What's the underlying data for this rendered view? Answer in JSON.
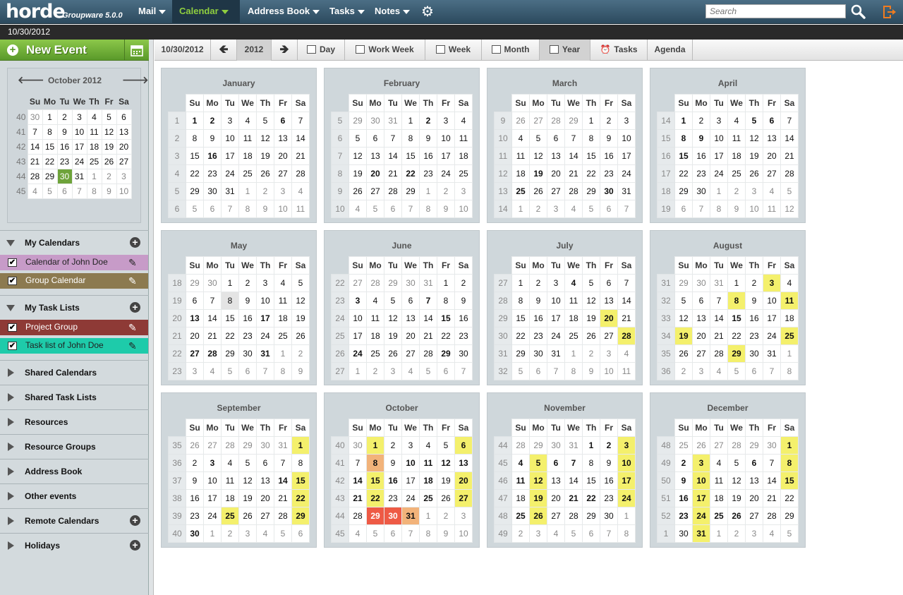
{
  "app": {
    "logo": "horde",
    "logo_sub": "Groupware 5.0.0"
  },
  "menu": [
    {
      "id": "mail",
      "label": "Mail"
    },
    {
      "id": "calendar",
      "label": "Calendar"
    },
    {
      "id": "addressbook",
      "label": "Address Book"
    },
    {
      "id": "tasks",
      "label": "Tasks"
    },
    {
      "id": "notes",
      "label": "Notes"
    }
  ],
  "search": {
    "placeholder": "Search"
  },
  "current_date": "10/30/2012",
  "sidebar": {
    "new_event": "New Event",
    "minical": {
      "title": "October 2012",
      "days": [
        "Su",
        "Mo",
        "Tu",
        "We",
        "Th",
        "Fr",
        "Sa"
      ],
      "weeks": [
        {
          "wk": "40",
          "d": [
            "30",
            "1",
            "2",
            "3",
            "4",
            "5",
            "6"
          ],
          "om": [
            0
          ]
        },
        {
          "wk": "41",
          "d": [
            "7",
            "8",
            "9",
            "10",
            "11",
            "12",
            "13"
          ],
          "om": []
        },
        {
          "wk": "42",
          "d": [
            "14",
            "15",
            "16",
            "17",
            "18",
            "19",
            "20"
          ],
          "om": []
        },
        {
          "wk": "43",
          "d": [
            "21",
            "22",
            "23",
            "24",
            "25",
            "26",
            "27"
          ],
          "om": []
        },
        {
          "wk": "44",
          "d": [
            "28",
            "29",
            "30",
            "31",
            "1",
            "2",
            "3"
          ],
          "om": [
            4,
            5,
            6
          ],
          "today": 2
        },
        {
          "wk": "45",
          "d": [
            "4",
            "5",
            "6",
            "7",
            "8",
            "9",
            "10"
          ],
          "om": [
            0,
            1,
            2,
            3,
            4,
            5,
            6
          ]
        }
      ]
    },
    "my_calendars": "My Calendars",
    "calendars": [
      {
        "name": "Calendar of John Doe",
        "color": "#c79bc8",
        "text": "#222"
      },
      {
        "name": "Group Calendar",
        "color": "#8c7a50",
        "text": "#fff"
      }
    ],
    "my_task_lists": "My Task Lists",
    "task_lists": [
      {
        "name": "Project Group",
        "color": "#8e3a36",
        "text": "#fff"
      },
      {
        "name": "Task list of John Doe",
        "color": "#1ecbaa",
        "text": "#222"
      }
    ],
    "sections": [
      {
        "label": "Shared Calendars",
        "add": false
      },
      {
        "label": "Shared Task Lists",
        "add": false
      },
      {
        "label": "Resources",
        "add": false
      },
      {
        "label": "Resource Groups",
        "add": false
      },
      {
        "label": "Address Book",
        "add": false
      },
      {
        "label": "Other events",
        "add": false
      },
      {
        "label": "Remote Calendars",
        "add": true
      },
      {
        "label": "Holidays",
        "add": true
      }
    ]
  },
  "toolbar": {
    "date": "10/30/2012",
    "year": "2012",
    "views": [
      "Day",
      "Work Week",
      "Week",
      "Month",
      "Year",
      "Tasks",
      "Agenda"
    ],
    "selected_view": "Year"
  },
  "year": {
    "day_headers": [
      "Su",
      "Mo",
      "Tu",
      "We",
      "Th",
      "Fr",
      "Sa"
    ],
    "months": [
      {
        "name": "January",
        "wk": [
          "1",
          "2",
          "3",
          "4",
          "5",
          "6"
        ],
        "days": [
          "1",
          "2",
          "3",
          "4",
          "5",
          "6",
          "7",
          "8",
          "9",
          "10",
          "11",
          "12",
          "13",
          "14",
          "15",
          "16",
          "17",
          "18",
          "19",
          "20",
          "21",
          "22",
          "23",
          "24",
          "25",
          "26",
          "27",
          "28",
          "29",
          "30",
          "31",
          "1",
          "2",
          "3",
          "4",
          "5",
          "6",
          "7",
          "8",
          "9",
          "10",
          "11"
        ],
        "first": 0,
        "len": 31,
        "bold": [
          1,
          2,
          6,
          16
        ]
      },
      {
        "name": "February",
        "wk": [
          "5",
          "6",
          "7",
          "8",
          "9",
          "10"
        ],
        "days": [
          "29",
          "30",
          "31",
          "1",
          "2",
          "3",
          "4",
          "5",
          "6",
          "7",
          "8",
          "9",
          "10",
          "11",
          "12",
          "13",
          "14",
          "15",
          "16",
          "17",
          "18",
          "19",
          "20",
          "21",
          "22",
          "23",
          "24",
          "25",
          "26",
          "27",
          "28",
          "29",
          "1",
          "2",
          "3",
          "4",
          "5",
          "6",
          "7",
          "8",
          "9",
          "10"
        ],
        "first": 3,
        "len": 29,
        "bold": [
          2,
          20,
          22
        ]
      },
      {
        "name": "March",
        "wk": [
          "9",
          "10",
          "11",
          "12",
          "13",
          "14"
        ],
        "days": [
          "26",
          "27",
          "28",
          "29",
          "1",
          "2",
          "3",
          "4",
          "5",
          "6",
          "7",
          "8",
          "9",
          "10",
          "11",
          "12",
          "13",
          "14",
          "15",
          "16",
          "17",
          "18",
          "19",
          "20",
          "21",
          "22",
          "23",
          "24",
          "25",
          "26",
          "27",
          "28",
          "29",
          "30",
          "31",
          "1",
          "2",
          "3",
          "4",
          "5",
          "6",
          "7"
        ],
        "first": 4,
        "len": 31,
        "bold": [
          19,
          25,
          30
        ]
      },
      {
        "name": "April",
        "wk": [
          "14",
          "15",
          "16",
          "17",
          "18",
          "19"
        ],
        "days": [
          "1",
          "2",
          "3",
          "4",
          "5",
          "6",
          "7",
          "8",
          "9",
          "10",
          "11",
          "12",
          "13",
          "14",
          "15",
          "16",
          "17",
          "18",
          "19",
          "20",
          "21",
          "22",
          "23",
          "24",
          "25",
          "26",
          "27",
          "28",
          "29",
          "30",
          "1",
          "2",
          "3",
          "4",
          "5",
          "6",
          "7",
          "8",
          "9",
          "10",
          "11",
          "12"
        ],
        "first": 0,
        "len": 30,
        "bold": [
          1,
          5,
          6,
          8,
          9,
          15
        ]
      },
      {
        "name": "May",
        "wk": [
          "18",
          "19",
          "20",
          "21",
          "22",
          "23"
        ],
        "days": [
          "29",
          "30",
          "1",
          "2",
          "3",
          "4",
          "5",
          "6",
          "7",
          "8",
          "9",
          "10",
          "11",
          "12",
          "13",
          "14",
          "15",
          "16",
          "17",
          "18",
          "19",
          "20",
          "21",
          "22",
          "23",
          "24",
          "25",
          "26",
          "27",
          "28",
          "29",
          "30",
          "31",
          "1",
          "2",
          "3",
          "4",
          "5",
          "6",
          "7",
          "8",
          "9"
        ],
        "first": 2,
        "len": 31,
        "bold": [
          13,
          17,
          27,
          28,
          31
        ],
        "gray": [
          8
        ]
      },
      {
        "name": "June",
        "wk": [
          "22",
          "23",
          "24",
          "25",
          "26",
          "27"
        ],
        "days": [
          "27",
          "28",
          "29",
          "30",
          "31",
          "1",
          "2",
          "3",
          "4",
          "5",
          "6",
          "7",
          "8",
          "9",
          "10",
          "11",
          "12",
          "13",
          "14",
          "15",
          "16",
          "17",
          "18",
          "19",
          "20",
          "21",
          "22",
          "23",
          "24",
          "25",
          "26",
          "27",
          "28",
          "29",
          "30",
          "1",
          "2",
          "3",
          "4",
          "5",
          "6",
          "7"
        ],
        "first": 5,
        "len": 30,
        "bold": [
          3,
          7,
          15,
          24,
          29
        ]
      },
      {
        "name": "July",
        "wk": [
          "27",
          "28",
          "29",
          "30",
          "31",
          "32"
        ],
        "days": [
          "1",
          "2",
          "3",
          "4",
          "5",
          "6",
          "7",
          "8",
          "9",
          "10",
          "11",
          "12",
          "13",
          "14",
          "15",
          "16",
          "17",
          "18",
          "19",
          "20",
          "21",
          "22",
          "23",
          "24",
          "25",
          "26",
          "27",
          "28",
          "29",
          "30",
          "31",
          "1",
          "2",
          "3",
          "4",
          "5",
          "6",
          "7",
          "8",
          "9",
          "10",
          "11"
        ],
        "first": 0,
        "len": 31,
        "bold": [
          4
        ],
        "yellow": [
          20,
          28
        ]
      },
      {
        "name": "August",
        "wk": [
          "31",
          "32",
          "33",
          "34",
          "35",
          "36"
        ],
        "days": [
          "29",
          "30",
          "31",
          "1",
          "2",
          "3",
          "4",
          "5",
          "6",
          "7",
          "8",
          "9",
          "10",
          "11",
          "12",
          "13",
          "14",
          "15",
          "16",
          "17",
          "18",
          "19",
          "20",
          "21",
          "22",
          "23",
          "24",
          "25",
          "26",
          "27",
          "28",
          "29",
          "30",
          "31",
          "1",
          "2",
          "3",
          "4",
          "5",
          "6",
          "7",
          "8"
        ],
        "first": 3,
        "len": 31,
        "bold": [
          15
        ],
        "yellow": [
          3,
          8,
          11,
          19,
          25,
          29
        ]
      },
      {
        "name": "September",
        "wk": [
          "35",
          "36",
          "37",
          "38",
          "39",
          "40"
        ],
        "days": [
          "26",
          "27",
          "28",
          "29",
          "30",
          "31",
          "1",
          "2",
          "3",
          "4",
          "5",
          "6",
          "7",
          "8",
          "9",
          "10",
          "11",
          "12",
          "13",
          "14",
          "15",
          "16",
          "17",
          "18",
          "19",
          "20",
          "21",
          "22",
          "23",
          "24",
          "25",
          "26",
          "27",
          "28",
          "29",
          "30",
          "1",
          "2",
          "3",
          "4",
          "5",
          "6"
        ],
        "first": 6,
        "len": 30,
        "bold": [
          3,
          14,
          30
        ],
        "yellow": [
          1,
          15,
          22,
          25,
          29
        ]
      },
      {
        "name": "October",
        "wk": [
          "40",
          "41",
          "42",
          "43",
          "44",
          "45"
        ],
        "days": [
          "30",
          "1",
          "2",
          "3",
          "4",
          "5",
          "6",
          "7",
          "8",
          "9",
          "10",
          "11",
          "12",
          "13",
          "14",
          "15",
          "16",
          "17",
          "18",
          "19",
          "20",
          "21",
          "22",
          "23",
          "24",
          "25",
          "26",
          "27",
          "28",
          "29",
          "30",
          "31",
          "1",
          "2",
          "3",
          "4",
          "5",
          "6",
          "7",
          "8",
          "9",
          "10"
        ],
        "first": 1,
        "len": 31,
        "bold": [
          10,
          11,
          12,
          13,
          14,
          16,
          18,
          21,
          25
        ],
        "yellow": [
          1,
          6,
          15,
          20,
          22,
          27
        ],
        "orange": [
          8,
          31
        ],
        "red": [
          29,
          30
        ]
      },
      {
        "name": "November",
        "wk": [
          "44",
          "45",
          "46",
          "47",
          "48",
          "49"
        ],
        "days": [
          "28",
          "29",
          "30",
          "31",
          "1",
          "2",
          "3",
          "4",
          "5",
          "6",
          "7",
          "8",
          "9",
          "10",
          "11",
          "12",
          "13",
          "14",
          "15",
          "16",
          "17",
          "18",
          "19",
          "20",
          "21",
          "22",
          "23",
          "24",
          "25",
          "26",
          "27",
          "28",
          "29",
          "30",
          "1",
          "2",
          "3",
          "4",
          "5",
          "6",
          "7",
          "8"
        ],
        "first": 4,
        "len": 30,
        "bold": [
          1,
          2,
          4,
          6,
          7,
          11,
          21,
          22,
          25
        ],
        "yellow": [
          3,
          5,
          10,
          12,
          17,
          19,
          24,
          26
        ]
      },
      {
        "name": "December",
        "wk": [
          "48",
          "49",
          "50",
          "51",
          "52",
          "1"
        ],
        "days": [
          "25",
          "26",
          "27",
          "28",
          "29",
          "30",
          "1",
          "2",
          "3",
          "4",
          "5",
          "6",
          "7",
          "8",
          "9",
          "10",
          "11",
          "12",
          "13",
          "14",
          "15",
          "16",
          "17",
          "18",
          "19",
          "20",
          "21",
          "22",
          "23",
          "24",
          "25",
          "26",
          "27",
          "28",
          "29",
          "30",
          "31",
          "1",
          "2",
          "3",
          "4",
          "5"
        ],
        "first": 6,
        "len": 31,
        "bold": [
          2,
          6,
          9,
          16,
          23,
          25,
          26
        ],
        "yellow": [
          1,
          3,
          8,
          10,
          15,
          17,
          24,
          31
        ]
      }
    ]
  }
}
